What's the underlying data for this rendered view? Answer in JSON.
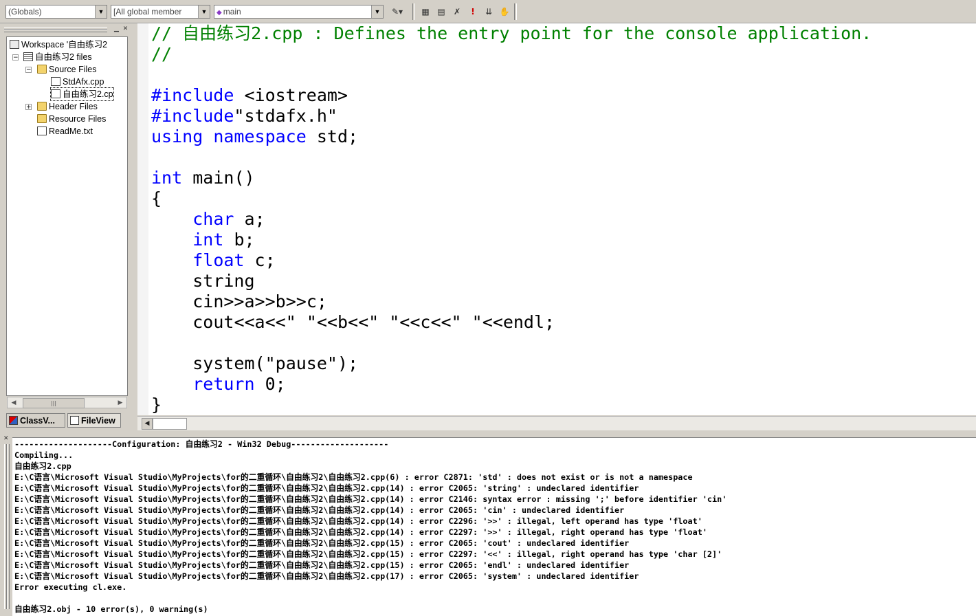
{
  "toolbar": {
    "scope_combo": "(Globals)",
    "members_combo": "[All global member",
    "function_combo": "main",
    "icons": [
      "wizard-action-icon",
      "compile-icon",
      "build-icon",
      "stop-build-icon",
      "execute-icon",
      "insert-breakpoint-icon",
      "go-icon"
    ]
  },
  "workspace": {
    "tree": [
      {
        "label": "Workspace '自由练习2",
        "icon": "workspace-icon"
      },
      {
        "label": "自由练习2 files",
        "icon": "project-icon"
      },
      {
        "label": "Source Files",
        "icon": "folder-icon"
      },
      {
        "label": "StdAfx.cpp",
        "icon": "cpp-file-icon"
      },
      {
        "label": "自由练习2.cp",
        "icon": "cpp-file-icon"
      },
      {
        "label": "Header Files",
        "icon": "folder-icon"
      },
      {
        "label": "Resource Files",
        "icon": "folder-icon"
      },
      {
        "label": "ReadMe.txt",
        "icon": "text-file-icon"
      }
    ],
    "tabs": {
      "class_view": "ClassV...",
      "file_view": "FileView"
    }
  },
  "editor": {
    "lines": [
      "// 自由练习2.cpp : Defines the entry point for the console application.",
      "//",
      "",
      "#include <iostream>",
      "#include\"stdafx.h\"",
      "using namespace std;",
      "",
      "int main()",
      "{",
      "    char a;",
      "    int b;",
      "    float c;",
      "    string",
      "    cin>>a>>b>>c;",
      "    cout<<a<<\" \"<<b<<\" \"<<c<<\" \"<<endl;",
      "",
      "    system(\"pause\");",
      "    return 0;",
      "}"
    ],
    "keywords": [
      "using",
      "namespace",
      "int",
      "char",
      "float",
      "return"
    ],
    "colors": {
      "keyword": "#0000ff",
      "comment": "#008000",
      "preprocessor": "#0000ff"
    }
  },
  "output": {
    "lines": [
      "--------------------Configuration: 自由练习2 - Win32 Debug--------------------",
      "Compiling...",
      "自由练习2.cpp",
      "E:\\C语言\\Microsoft Visual Studio\\MyProjects\\for的二重循环\\自由练习2\\自由练习2.cpp(6) : error C2871: 'std' : does not exist or is not a namespace",
      "E:\\C语言\\Microsoft Visual Studio\\MyProjects\\for的二重循环\\自由练习2\\自由练习2.cpp(14) : error C2065: 'string' : undeclared identifier",
      "E:\\C语言\\Microsoft Visual Studio\\MyProjects\\for的二重循环\\自由练习2\\自由练习2.cpp(14) : error C2146: syntax error : missing ';' before identifier 'cin'",
      "E:\\C语言\\Microsoft Visual Studio\\MyProjects\\for的二重循环\\自由练习2\\自由练习2.cpp(14) : error C2065: 'cin' : undeclared identifier",
      "E:\\C语言\\Microsoft Visual Studio\\MyProjects\\for的二重循环\\自由练习2\\自由练习2.cpp(14) : error C2296: '>>' : illegal, left operand has type 'float'",
      "E:\\C语言\\Microsoft Visual Studio\\MyProjects\\for的二重循环\\自由练习2\\自由练习2.cpp(14) : error C2297: '>>' : illegal, right operand has type 'float'",
      "E:\\C语言\\Microsoft Visual Studio\\MyProjects\\for的二重循环\\自由练习2\\自由练习2.cpp(15) : error C2065: 'cout' : undeclared identifier",
      "E:\\C语言\\Microsoft Visual Studio\\MyProjects\\for的二重循环\\自由练习2\\自由练习2.cpp(15) : error C2297: '<<' : illegal, right operand has type 'char [2]'",
      "E:\\C语言\\Microsoft Visual Studio\\MyProjects\\for的二重循环\\自由练习2\\自由练习2.cpp(15) : error C2065: 'endl' : undeclared identifier",
      "E:\\C语言\\Microsoft Visual Studio\\MyProjects\\for的二重循环\\自由练习2\\自由练习2.cpp(17) : error C2065: 'system' : undeclared identifier",
      "Error executing cl.exe.",
      "",
      "自由练习2.obj - 10 error(s), 0 warning(s)"
    ]
  }
}
